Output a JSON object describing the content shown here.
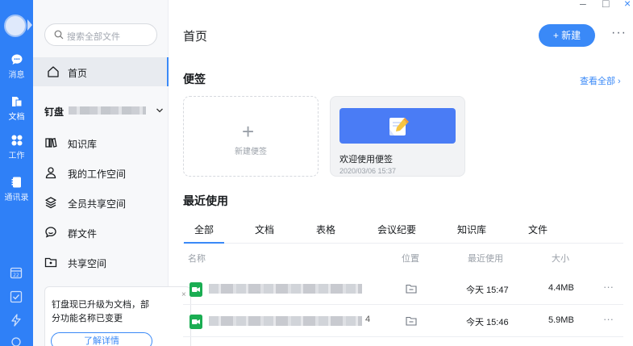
{
  "rail": {
    "items": [
      {
        "label": "消息",
        "icon": "chat-bubble-icon"
      },
      {
        "label": "文档",
        "icon": "document-icon"
      },
      {
        "label": "工作",
        "icon": "apps-grid-icon"
      },
      {
        "label": "通讯录",
        "icon": "contacts-icon"
      }
    ]
  },
  "side": {
    "search_placeholder": "搜索全部文件",
    "home": "首页",
    "drive_label": "钉盘",
    "nav": [
      "知识库",
      "我的工作空间",
      "全员共享空间",
      "群文件",
      "共享空间"
    ],
    "notice": {
      "text": "钉盘现已升级为文档，部分功能名称已变更",
      "button": "了解详情",
      "close": "×"
    }
  },
  "window": {
    "minimize": "–",
    "maximize": "□",
    "close": "×"
  },
  "main": {
    "title": "首页",
    "new_button": "+ 新建",
    "more": "···",
    "notes_title": "便签",
    "view_all": "查看全部 ›",
    "new_note": "新建便签",
    "note": {
      "title": "欢迎使用便签",
      "date": "2020/03/06 15:37"
    },
    "recent_title": "最近使用",
    "tabs": [
      "全部",
      "文档",
      "表格",
      "会议纪要",
      "知识库",
      "文件"
    ],
    "columns": {
      "name": "名称",
      "location": "位置",
      "recent": "最近使用",
      "size": "大小"
    },
    "rows": [
      {
        "suffix": "",
        "time": "今天 15:47",
        "size": "4.4MB"
      },
      {
        "suffix": "4",
        "time": "今天 15:46",
        "size": "5.9MB"
      }
    ]
  },
  "colors": {
    "accent": "#3a89f7",
    "rail": "#2f80f7",
    "sheet": "#1aad52"
  }
}
